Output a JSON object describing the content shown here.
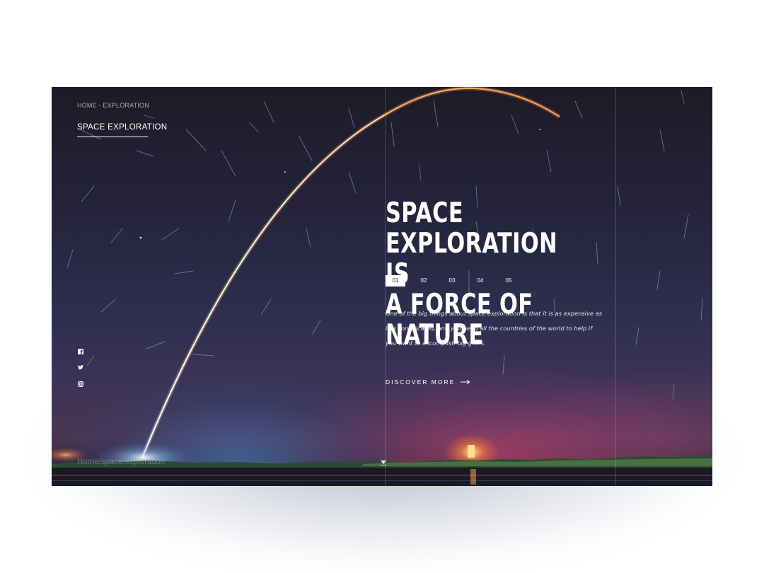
{
  "breadcrumb": "HOME - EXPLORATION",
  "page_title": "SPACE EXPLORATION",
  "headline": {
    "line1": "SPACE EXPLORATION IS",
    "line2": "A FORCE OF NATURE"
  },
  "pager": {
    "items": [
      "01",
      "02",
      "03",
      "04",
      "05"
    ],
    "active": "01"
  },
  "description": {
    "line1": "One of the big things about space exploration is that it is as expensive as",
    "line2": "it is complicated, and you need all the countries of the world to help if",
    "line3": "you want to accomplish big goals."
  },
  "cta_label": "DISCOVER MORE",
  "footer_breadcrumb": "Home/space/exploration",
  "social_icons": [
    "facebook-icon",
    "twitter-icon",
    "instagram-icon"
  ],
  "colors": {
    "text": "#ffffff",
    "active_page_bg": "#ffffff",
    "active_page_text": "#1e1b27",
    "rocket_trail": "#ffd9a0"
  }
}
